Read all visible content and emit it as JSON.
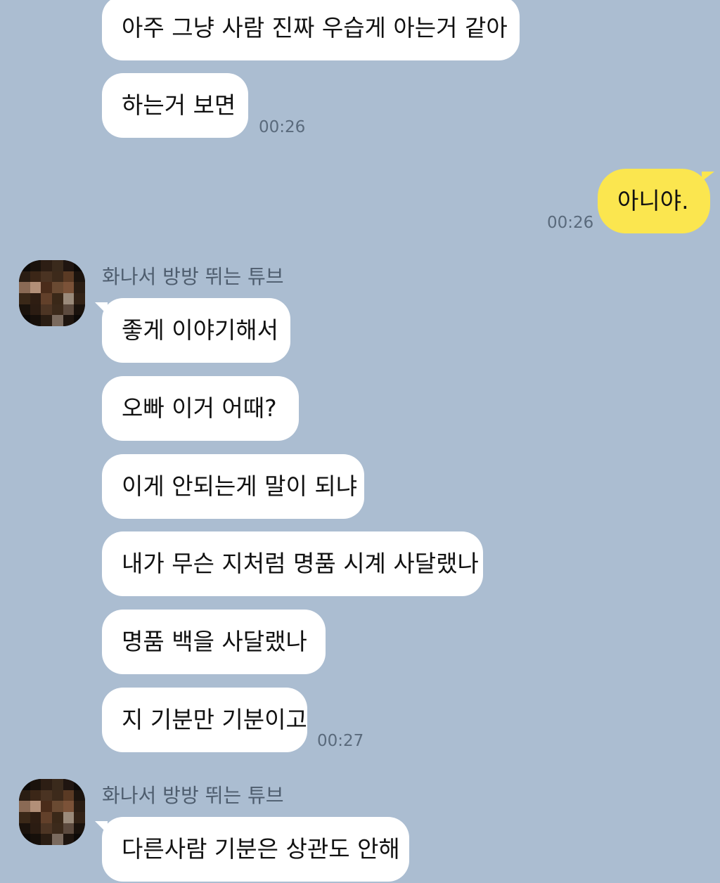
{
  "chat": {
    "messages_top": [
      {
        "text": "아주 그냥 사람 진짜 우습게 아는거 같아"
      },
      {
        "text": "하는거 보면"
      }
    ],
    "time_1": "00:26",
    "mine": {
      "text": "아니야.",
      "time": "00:26"
    },
    "group_1": {
      "sender": "화나서 방방 뛰는 튜브",
      "messages": [
        {
          "text": "좋게 이야기해서"
        },
        {
          "text": "오빠 이거 어때?"
        },
        {
          "text": "이게 안되는게 말이 되냐"
        },
        {
          "text": "내가 무슨 지처럼 명품 시계 사달랬나"
        },
        {
          "text": "명품 백을 사달랬나"
        },
        {
          "text": "지 기분만 기분이고"
        }
      ],
      "time": "00:27"
    },
    "group_2": {
      "sender": "화나서 방방 뛰는 튜브",
      "messages": [
        {
          "text": "다른사람 기분은 상관도 안해"
        }
      ]
    }
  },
  "colors": {
    "background": "#abbdd1",
    "bubble_other": "#ffffff",
    "bubble_mine": "#fbe64f"
  }
}
